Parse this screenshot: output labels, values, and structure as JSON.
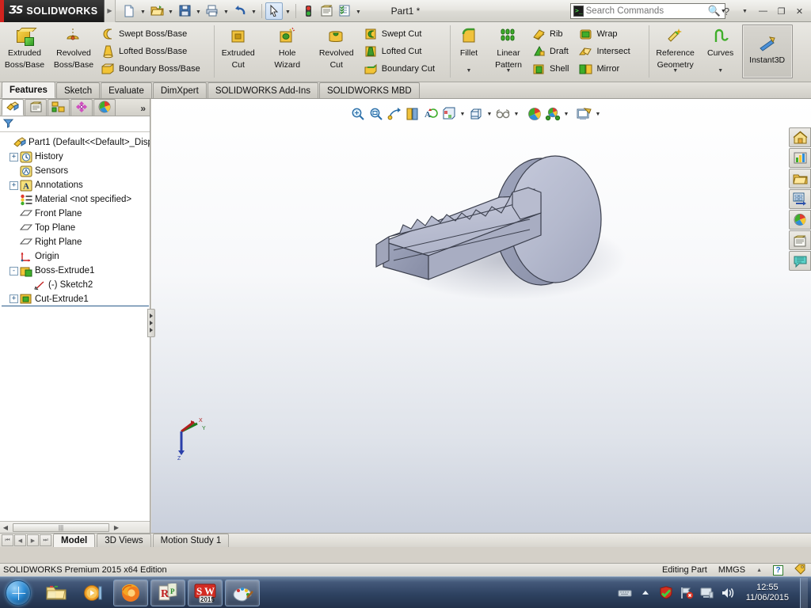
{
  "titlebar": {
    "brand_ds": "ƷS",
    "brand_name": "SOLIDWORKS",
    "document_title": "Part1 *",
    "quick_access": [
      {
        "name": "new-document",
        "label": "New"
      },
      {
        "name": "open-document",
        "label": "Open"
      },
      {
        "name": "save-document",
        "label": "Save"
      },
      {
        "name": "print-document",
        "label": "Print"
      },
      {
        "name": "undo",
        "label": "Undo"
      },
      {
        "name": "select",
        "label": "Select"
      },
      {
        "name": "rebuild",
        "label": "Rebuild"
      },
      {
        "name": "file-properties",
        "label": "File Properties"
      },
      {
        "name": "options",
        "label": "Options"
      }
    ],
    "search": {
      "placeholder": "Search Commands",
      "value": ""
    },
    "help_label": "?",
    "window_buttons": [
      "minimize",
      "restore",
      "close"
    ]
  },
  "ribbon": {
    "groups": [
      {
        "name": "boss-base-group",
        "big": [
          {
            "label_line1": "Extruded",
            "label_line2": "Boss/Base",
            "icon": "extruded-boss-icon"
          },
          {
            "label_line1": "Revolved",
            "label_line2": "Boss/Base",
            "icon": "revolved-boss-icon"
          }
        ],
        "small": [
          {
            "label": "Swept Boss/Base",
            "icon": "swept-boss-icon"
          },
          {
            "label": "Lofted Boss/Base",
            "icon": "lofted-boss-icon"
          },
          {
            "label": "Boundary Boss/Base",
            "icon": "boundary-boss-icon"
          }
        ]
      },
      {
        "name": "cut-group",
        "big": [
          {
            "label_line1": "Extruded",
            "label_line2": "Cut",
            "icon": "extruded-cut-icon"
          },
          {
            "label_line1": "Hole",
            "label_line2": "Wizard",
            "icon": "hole-wizard-icon"
          },
          {
            "label_line1": "Revolved",
            "label_line2": "Cut",
            "icon": "revolved-cut-icon"
          }
        ],
        "small": [
          {
            "label": "Swept Cut",
            "icon": "swept-cut-icon"
          },
          {
            "label": "Lofted Cut",
            "icon": "lofted-cut-icon"
          },
          {
            "label": "Boundary Cut",
            "icon": "boundary-cut-icon"
          }
        ]
      },
      {
        "name": "features-group",
        "big": [
          {
            "label_line1": "Fillet",
            "label_line2": "",
            "icon": "fillet-icon",
            "caret": true
          },
          {
            "label_line1": "Linear",
            "label_line2": "Pattern",
            "icon": "linear-pattern-icon",
            "caret": true
          }
        ],
        "small": [
          {
            "label": "Rib",
            "icon": "rib-icon"
          },
          {
            "label": "Draft",
            "icon": "draft-icon"
          },
          {
            "label": "Shell",
            "icon": "shell-icon"
          }
        ],
        "small2": [
          {
            "label": "Wrap",
            "icon": "wrap-icon"
          },
          {
            "label": "Intersect",
            "icon": "intersect-icon"
          },
          {
            "label": "Mirror",
            "icon": "mirror-icon"
          }
        ]
      },
      {
        "name": "reference-group",
        "big": [
          {
            "label_line1": "Reference",
            "label_line2": "Geometry",
            "icon": "reference-geometry-icon",
            "caret": true
          },
          {
            "label_line1": "Curves",
            "label_line2": "",
            "icon": "curves-icon",
            "caret": true
          }
        ],
        "boxed": [
          {
            "label_line1": "Instant3D",
            "label_line2": "",
            "icon": "instant3d-icon"
          }
        ]
      }
    ]
  },
  "command_tabs": [
    {
      "label": "Features",
      "active": true
    },
    {
      "label": "Sketch",
      "active": false
    },
    {
      "label": "Evaluate",
      "active": false
    },
    {
      "label": "DimXpert",
      "active": false
    },
    {
      "label": "SOLIDWORKS Add-Ins",
      "active": false
    },
    {
      "label": "SOLIDWORKS MBD",
      "active": false
    }
  ],
  "manager_tabs": [
    {
      "name": "feature-manager-tab",
      "icon": "feature-tree-icon",
      "active": true
    },
    {
      "name": "property-manager-tab",
      "icon": "property-manager-icon",
      "active": false
    },
    {
      "name": "configuration-manager-tab",
      "icon": "configuration-manager-icon",
      "active": false
    },
    {
      "name": "dimxpert-manager-tab",
      "icon": "dimxpert-icon",
      "active": false
    },
    {
      "name": "display-manager-tab",
      "icon": "display-manager-icon",
      "active": false
    }
  ],
  "manager_more": "»",
  "filter": {
    "placeholder": "",
    "value": "",
    "icon": "filter-icon"
  },
  "tree": [
    {
      "label": "Part1  (Default<<Default>_Disp",
      "icon": "part-icon",
      "expander": "none",
      "indent": 0
    },
    {
      "label": "History",
      "icon": "history-icon",
      "expander": "+",
      "indent": 1
    },
    {
      "label": "Sensors",
      "icon": "sensors-icon",
      "expander": "none",
      "indent": 1
    },
    {
      "label": "Annotations",
      "icon": "annotations-icon",
      "expander": "+",
      "indent": 1
    },
    {
      "label": "Material <not specified>",
      "icon": "material-icon",
      "expander": "none",
      "indent": 1
    },
    {
      "label": "Front Plane",
      "icon": "plane-icon",
      "expander": "none",
      "indent": 1
    },
    {
      "label": "Top Plane",
      "icon": "plane-icon",
      "expander": "none",
      "indent": 1
    },
    {
      "label": "Right Plane",
      "icon": "plane-icon",
      "expander": "none",
      "indent": 1
    },
    {
      "label": "Origin",
      "icon": "origin-icon",
      "expander": "none",
      "indent": 1
    },
    {
      "label": "Boss-Extrude1",
      "icon": "boss-extrude-icon",
      "expander": "-",
      "indent": 1
    },
    {
      "label": "(-) Sketch2",
      "icon": "sketch-icon",
      "expander": "none",
      "indent": 2
    },
    {
      "label": "Cut-Extrude1",
      "icon": "cut-extrude-icon",
      "expander": "+",
      "indent": 1
    }
  ],
  "view_toolbar": [
    {
      "name": "zoom-to-fit-icon",
      "dropdown": false
    },
    {
      "name": "zoom-to-area-icon",
      "dropdown": false
    },
    {
      "name": "previous-view-icon",
      "dropdown": false
    },
    {
      "name": "section-view-icon",
      "dropdown": false
    },
    {
      "name": "view-orientation-icon",
      "dropdown": false
    },
    {
      "name": "display-style-icon",
      "dropdown": true
    },
    {
      "name": "hide-show-items-icon",
      "dropdown": true
    },
    {
      "name": "edit-appearance-icon",
      "dropdown": true
    },
    {
      "name": "apply-scene-icon",
      "dropdown": true
    },
    {
      "name": "view-settings-icon",
      "dropdown": true
    }
  ],
  "document_window_buttons": [
    "restore-left",
    "restore-right",
    "minimize",
    "restore",
    "close"
  ],
  "task_pane": [
    {
      "name": "solidworks-resources-icon",
      "label": "SOLIDWORKS Resources"
    },
    {
      "name": "design-library-icon",
      "label": "Design Library"
    },
    {
      "name": "file-explorer-icon",
      "label": "File Explorer"
    },
    {
      "name": "view-palette-icon",
      "label": "View Palette"
    },
    {
      "name": "appearances-scenes-icon",
      "label": "Appearances, Scenes and Decals"
    },
    {
      "name": "custom-properties-icon",
      "label": "Custom Properties"
    },
    {
      "name": "solidworks-forum-icon",
      "label": "SOLIDWORKS Forum"
    }
  ],
  "triad": {
    "x_label": "X",
    "y_label": "Y",
    "z_label": "Z"
  },
  "model": {
    "name": "key-part",
    "description": "3D key with circular bow and toothed blade"
  },
  "bottom_tabs": [
    {
      "label": "Model",
      "active": true
    },
    {
      "label": "3D Views",
      "active": false
    },
    {
      "label": "Motion Study 1",
      "active": false
    }
  ],
  "statusbar": {
    "left": "SOLIDWORKS Premium 2015 x64 Edition",
    "editing_state": "Editing Part",
    "units": "MMGS",
    "help_badge": "?",
    "caret": "▲"
  },
  "taskbar": {
    "start": "start-orb",
    "pinned": [
      {
        "name": "windows-explorer-icon",
        "label": "Windows Explorer"
      },
      {
        "name": "media-player-icon",
        "label": "Windows Media Player"
      }
    ],
    "windows": [
      {
        "name": "firefox-icon",
        "label": "Mozilla Firefox"
      },
      {
        "name": "r-studio-icon",
        "label": "R"
      },
      {
        "name": "solidworks-2015-icon",
        "label": "SOLIDWORKS 2015"
      },
      {
        "name": "paint-icon",
        "label": "Paint"
      }
    ],
    "tray": [
      {
        "name": "keyboard-icon"
      },
      {
        "name": "show-hidden-icons-icon"
      },
      {
        "name": "antivirus-icon"
      },
      {
        "name": "network-icon"
      },
      {
        "name": "action-center-icon"
      },
      {
        "name": "volume-icon"
      }
    ],
    "clock_time": "12:55",
    "clock_date": "11/06/2015"
  },
  "colors": {
    "brand_red": "#d2231e",
    "ribbon_bg": "#dedcd6",
    "accent_blue": "#2f6fb0",
    "model_fill": "#b5b9cc",
    "taskbar": "#2e4261"
  }
}
